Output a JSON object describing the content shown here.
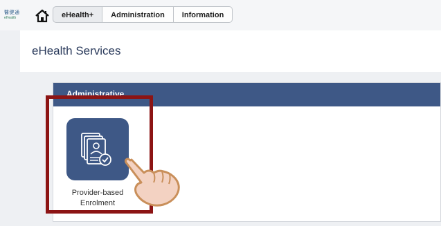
{
  "logo": {
    "line1": "醫健通",
    "line2": "eHealth"
  },
  "nav": {
    "tabs": [
      {
        "label": "eHealth+"
      },
      {
        "label": "Administration"
      },
      {
        "label": "Information"
      }
    ]
  },
  "header": {
    "title": "eHealth Services"
  },
  "section": {
    "title": "Administrative"
  },
  "tile": {
    "label_line1": "Provider-based",
    "label_line2": "Enrolment"
  },
  "colors": {
    "accent": "#3e5886",
    "highlight": "#8c1414",
    "title_text": "#2b3b5c"
  },
  "icons": [
    "home-icon",
    "enrolment-document-icon",
    "pointing-hand-icon"
  ]
}
